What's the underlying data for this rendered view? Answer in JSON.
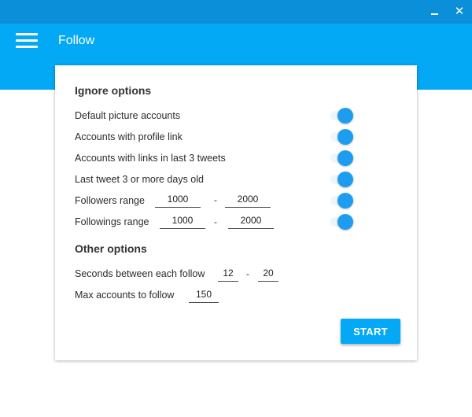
{
  "window": {
    "minimize_label": "",
    "close_label": "✕"
  },
  "appbar": {
    "title": "Follow"
  },
  "ignore_options": {
    "title": "Ignore options",
    "items": [
      {
        "label": "Default picture accounts",
        "enabled": true
      },
      {
        "label": "Accounts with profile link",
        "enabled": true
      },
      {
        "label": "Accounts with links in last 3 tweets",
        "enabled": true
      },
      {
        "label": "Last tweet 3 or more days old",
        "enabled": true
      },
      {
        "label": "Followers range",
        "enabled": true,
        "min": "1000",
        "max": "2000"
      },
      {
        "label": "Followings range",
        "enabled": true,
        "min": "1000",
        "max": "2000"
      }
    ],
    "range_separator": "-"
  },
  "other_options": {
    "title": "Other options",
    "seconds_label": "Seconds between each follow",
    "seconds_min": "12",
    "seconds_max": "20",
    "separator": "-",
    "max_accounts_label": "Max accounts to follow",
    "max_accounts": "150"
  },
  "actions": {
    "start_label": "START"
  },
  "colors": {
    "titlebar": "#0a8fd8",
    "appbar": "#03a9f4",
    "toggle_on": "#1e9df0"
  }
}
